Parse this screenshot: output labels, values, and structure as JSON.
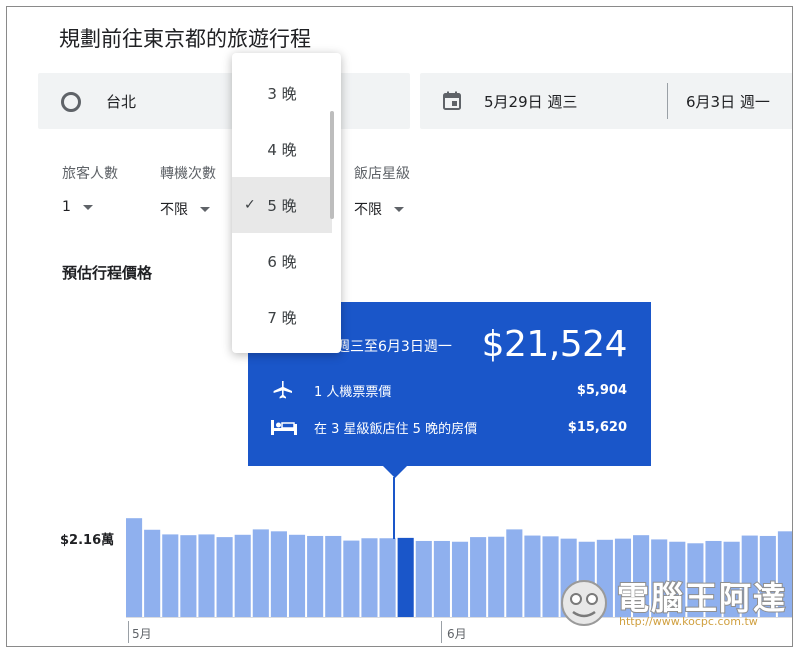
{
  "page_title": "規劃前往東京都的旅遊行程",
  "search": {
    "origin": "台北",
    "depart_date": "5月29日 週三",
    "return_date": "6月3日 週一"
  },
  "filters": [
    {
      "label": "旅客人數",
      "value": "1"
    },
    {
      "label": "轉機次數",
      "value": "不限"
    },
    {
      "label": "飯店星級",
      "value": "不限"
    }
  ],
  "nights_dropdown": {
    "options": [
      "3 晚",
      "4 晚",
      "5 晚",
      "6 晚",
      "7 晚"
    ],
    "selected": "5 晚",
    "check_icon": "checkmark-icon"
  },
  "section_title": "預估行程價格",
  "tooltip": {
    "dates": "週三至6月3日週一",
    "total": "$21,524",
    "rows": [
      {
        "icon": "airplane-icon",
        "label": "1 人機票票價",
        "price": "$5,904"
      },
      {
        "icon": "hotel-bed-icon",
        "label": "在 3 星級飯店住 5 晚的房價",
        "price": "$15,620"
      }
    ],
    "background_color": "#1a56c9"
  },
  "chart_data": {
    "type": "bar",
    "title": "",
    "reference_label": "$2.16萬",
    "month_labels": [
      "5月",
      "6月"
    ],
    "highlighted_index": 15,
    "colors": {
      "bar": "#8fb0ee",
      "highlight": "#1a56c9"
    },
    "values": [
      2.56,
      2.26,
      2.14,
      2.12,
      2.14,
      2.07,
      2.13,
      2.27,
      2.22,
      2.13,
      2.1,
      2.1,
      1.98,
      2.04,
      2.04,
      2.05,
      1.97,
      1.97,
      1.95,
      2.07,
      2.08,
      2.27,
      2.11,
      2.09,
      2.03,
      1.95,
      2.0,
      2.03,
      2.12,
      2.01,
      1.95,
      1.91,
      1.97,
      1.95,
      2.11,
      2.1,
      2.22
    ]
  },
  "watermark": {
    "text": "電腦王阿達",
    "url": "http://www.kocpc.com.tw"
  }
}
